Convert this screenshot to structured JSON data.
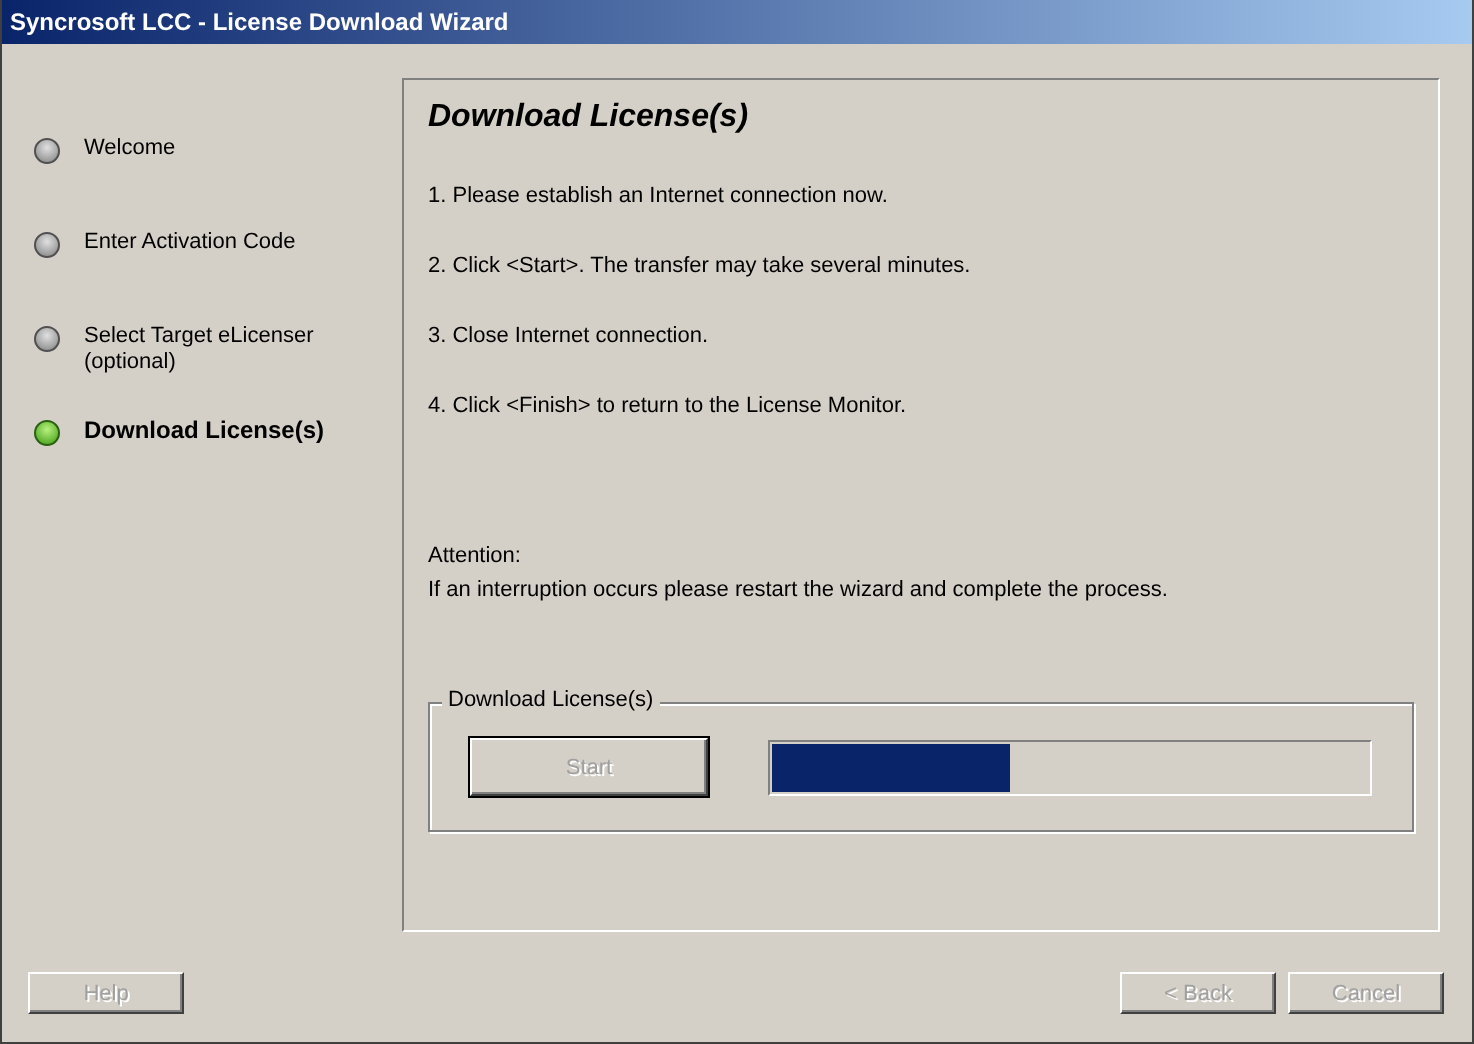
{
  "window": {
    "title": "Syncrosoft LCC - License Download Wizard"
  },
  "steps": [
    {
      "label": "Welcome",
      "selected": false
    },
    {
      "label": "Enter Activation Code",
      "selected": false
    },
    {
      "label": "Select Target eLicenser (optional)",
      "selected": false
    },
    {
      "label": "Download License(s)",
      "selected": true
    }
  ],
  "page": {
    "heading": "Download License(s)",
    "instructions": [
      "1.  Please establish an Internet connection now.",
      "2.  Click <Start>. The transfer may take several minutes.",
      "3.  Close Internet connection.",
      "4.  Click <Finish> to return to the License Monitor."
    ],
    "attention": "Attention:",
    "attention_text": "If an interruption occurs please restart the wizard and complete the process.",
    "group": {
      "title": "Download License(s)",
      "button": {
        "label": "Start",
        "disabled": true
      },
      "progress": {
        "level": 0.4
      }
    }
  },
  "buttons": [
    {
      "label": "Help",
      "disabled": true
    },
    {
      "label": "< Back",
      "disabled": true
    },
    {
      "label": "Cancel",
      "disabled": true
    }
  ]
}
